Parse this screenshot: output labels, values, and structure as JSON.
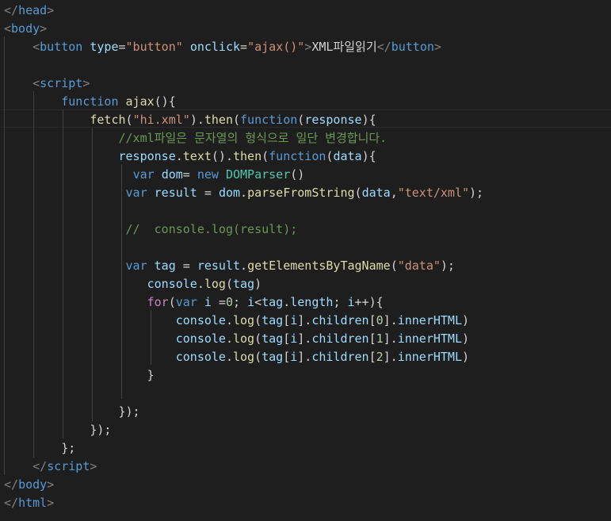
{
  "theme": {
    "background": "#1e1e1e",
    "tag": "#569cd6",
    "punct": "#808080",
    "attr": "#9cdcfe",
    "string": "#ce9178",
    "keyword": "#569cd6",
    "control": "#c586c0",
    "function": "#dcdcaa",
    "variable": "#9cdcfe",
    "class": "#4ec9b0",
    "number": "#b5cea8",
    "comment": "#6a9955",
    "text": "#d4d4d4"
  },
  "lines": [
    [
      [
        "punct",
        "</"
      ],
      [
        "tag",
        "head"
      ],
      [
        "punct",
        ">"
      ]
    ],
    [
      [
        "punct",
        "<"
      ],
      [
        "tag",
        "body"
      ],
      [
        "punct",
        ">"
      ]
    ],
    [
      [
        "text",
        "    "
      ],
      [
        "punct",
        "<"
      ],
      [
        "tag",
        "button"
      ],
      [
        "text",
        " "
      ],
      [
        "attr",
        "type"
      ],
      [
        "text",
        "="
      ],
      [
        "str",
        "\"button\""
      ],
      [
        "text",
        " "
      ],
      [
        "attr",
        "onclick"
      ],
      [
        "text",
        "="
      ],
      [
        "str",
        "\"ajax()\""
      ],
      [
        "punct",
        ">"
      ],
      [
        "text",
        "XML파일읽기"
      ],
      [
        "punct",
        "</"
      ],
      [
        "tag",
        "button"
      ],
      [
        "punct",
        ">"
      ]
    ],
    [
      [
        "text",
        ""
      ]
    ],
    [
      [
        "text",
        "    "
      ],
      [
        "punct",
        "<"
      ],
      [
        "tag",
        "script"
      ],
      [
        "punct",
        ">"
      ]
    ],
    [
      [
        "text",
        "        "
      ],
      [
        "kw",
        "function"
      ],
      [
        "text",
        " "
      ],
      [
        "fn",
        "ajax"
      ],
      [
        "plain",
        "(){"
      ]
    ],
    [
      [
        "text",
        "            "
      ],
      [
        "fn",
        "fetch"
      ],
      [
        "plain",
        "("
      ],
      [
        "str",
        "\"hi.xml\""
      ],
      [
        "plain",
        ")."
      ],
      [
        "fn",
        "then"
      ],
      [
        "plain",
        "("
      ],
      [
        "kw",
        "function"
      ],
      [
        "plain",
        "("
      ],
      [
        "var",
        "response"
      ],
      [
        "plain",
        "){"
      ]
    ],
    [
      [
        "text",
        "                "
      ],
      [
        "comment",
        "//xml파일은 문자열의 형식으로 일단 변경합니다."
      ]
    ],
    [
      [
        "text",
        "                "
      ],
      [
        "var",
        "response"
      ],
      [
        "plain",
        "."
      ],
      [
        "fn",
        "text"
      ],
      [
        "plain",
        "()."
      ],
      [
        "fn",
        "then"
      ],
      [
        "plain",
        "("
      ],
      [
        "kw",
        "function"
      ],
      [
        "plain",
        "("
      ],
      [
        "var",
        "data"
      ],
      [
        "plain",
        "){"
      ]
    ],
    [
      [
        "text",
        "                  "
      ],
      [
        "kw",
        "var"
      ],
      [
        "text",
        " "
      ],
      [
        "var",
        "dom"
      ],
      [
        "plain",
        "= "
      ],
      [
        "kw",
        "new"
      ],
      [
        "text",
        " "
      ],
      [
        "cls",
        "DOMParser"
      ],
      [
        "plain",
        "()"
      ]
    ],
    [
      [
        "text",
        "                 "
      ],
      [
        "kw",
        "var"
      ],
      [
        "text",
        " "
      ],
      [
        "var",
        "result"
      ],
      [
        "plain",
        " = "
      ],
      [
        "var",
        "dom"
      ],
      [
        "plain",
        "."
      ],
      [
        "fn",
        "parseFromString"
      ],
      [
        "plain",
        "("
      ],
      [
        "var",
        "data"
      ],
      [
        "plain",
        ","
      ],
      [
        "str",
        "\"text/xml\""
      ],
      [
        "plain",
        ");"
      ]
    ],
    [
      [
        "text",
        ""
      ]
    ],
    [
      [
        "text",
        "                 "
      ],
      [
        "comment",
        "//  console.log(result);"
      ]
    ],
    [
      [
        "text",
        ""
      ]
    ],
    [
      [
        "text",
        "                 "
      ],
      [
        "kw",
        "var"
      ],
      [
        "text",
        " "
      ],
      [
        "var",
        "tag"
      ],
      [
        "plain",
        " = "
      ],
      [
        "var",
        "result"
      ],
      [
        "plain",
        "."
      ],
      [
        "fn",
        "getElementsByTagName"
      ],
      [
        "plain",
        "("
      ],
      [
        "str",
        "\"data\""
      ],
      [
        "plain",
        ");"
      ]
    ],
    [
      [
        "text",
        "                    "
      ],
      [
        "var",
        "console"
      ],
      [
        "plain",
        "."
      ],
      [
        "fn",
        "log"
      ],
      [
        "plain",
        "("
      ],
      [
        "var",
        "tag"
      ],
      [
        "plain",
        ")"
      ]
    ],
    [
      [
        "text",
        "                    "
      ],
      [
        "ctrl",
        "for"
      ],
      [
        "plain",
        "("
      ],
      [
        "kw",
        "var"
      ],
      [
        "text",
        " "
      ],
      [
        "var",
        "i"
      ],
      [
        "plain",
        " ="
      ],
      [
        "num",
        "0"
      ],
      [
        "plain",
        "; "
      ],
      [
        "var",
        "i"
      ],
      [
        "plain",
        "<"
      ],
      [
        "var",
        "tag"
      ],
      [
        "plain",
        "."
      ],
      [
        "var",
        "length"
      ],
      [
        "plain",
        "; "
      ],
      [
        "var",
        "i"
      ],
      [
        "plain",
        "++){"
      ]
    ],
    [
      [
        "text",
        "                        "
      ],
      [
        "var",
        "console"
      ],
      [
        "plain",
        "."
      ],
      [
        "fn",
        "log"
      ],
      [
        "plain",
        "("
      ],
      [
        "var",
        "tag"
      ],
      [
        "plain",
        "["
      ],
      [
        "var",
        "i"
      ],
      [
        "plain",
        "]."
      ],
      [
        "var",
        "children"
      ],
      [
        "plain",
        "["
      ],
      [
        "num",
        "0"
      ],
      [
        "plain",
        "]."
      ],
      [
        "var",
        "innerHTML"
      ],
      [
        "plain",
        ")"
      ]
    ],
    [
      [
        "text",
        "                        "
      ],
      [
        "var",
        "console"
      ],
      [
        "plain",
        "."
      ],
      [
        "fn",
        "log"
      ],
      [
        "plain",
        "("
      ],
      [
        "var",
        "tag"
      ],
      [
        "plain",
        "["
      ],
      [
        "var",
        "i"
      ],
      [
        "plain",
        "]."
      ],
      [
        "var",
        "children"
      ],
      [
        "plain",
        "["
      ],
      [
        "num",
        "1"
      ],
      [
        "plain",
        "]."
      ],
      [
        "var",
        "innerHTML"
      ],
      [
        "plain",
        ")"
      ]
    ],
    [
      [
        "text",
        "                        "
      ],
      [
        "var",
        "console"
      ],
      [
        "plain",
        "."
      ],
      [
        "fn",
        "log"
      ],
      [
        "plain",
        "("
      ],
      [
        "var",
        "tag"
      ],
      [
        "plain",
        "["
      ],
      [
        "var",
        "i"
      ],
      [
        "plain",
        "]."
      ],
      [
        "var",
        "children"
      ],
      [
        "plain",
        "["
      ],
      [
        "num",
        "2"
      ],
      [
        "plain",
        "]."
      ],
      [
        "var",
        "innerHTML"
      ],
      [
        "plain",
        ")"
      ]
    ],
    [
      [
        "text",
        "                    "
      ],
      [
        "plain",
        "}"
      ]
    ],
    [
      [
        "text",
        ""
      ]
    ],
    [
      [
        "text",
        "                "
      ],
      [
        "plain",
        "});"
      ]
    ],
    [
      [
        "text",
        "            "
      ],
      [
        "plain",
        "});"
      ]
    ],
    [
      [
        "text",
        "        "
      ],
      [
        "plain",
        "};"
      ]
    ],
    [
      [
        "text",
        "    "
      ],
      [
        "punct",
        "</"
      ],
      [
        "tag",
        "script"
      ],
      [
        "punct",
        ">"
      ]
    ],
    [
      [
        "punct",
        "</"
      ],
      [
        "tag",
        "body"
      ],
      [
        "punct",
        ">"
      ]
    ],
    [
      [
        "punct",
        "</"
      ],
      [
        "tag",
        "html"
      ],
      [
        "punct",
        ">"
      ]
    ]
  ]
}
